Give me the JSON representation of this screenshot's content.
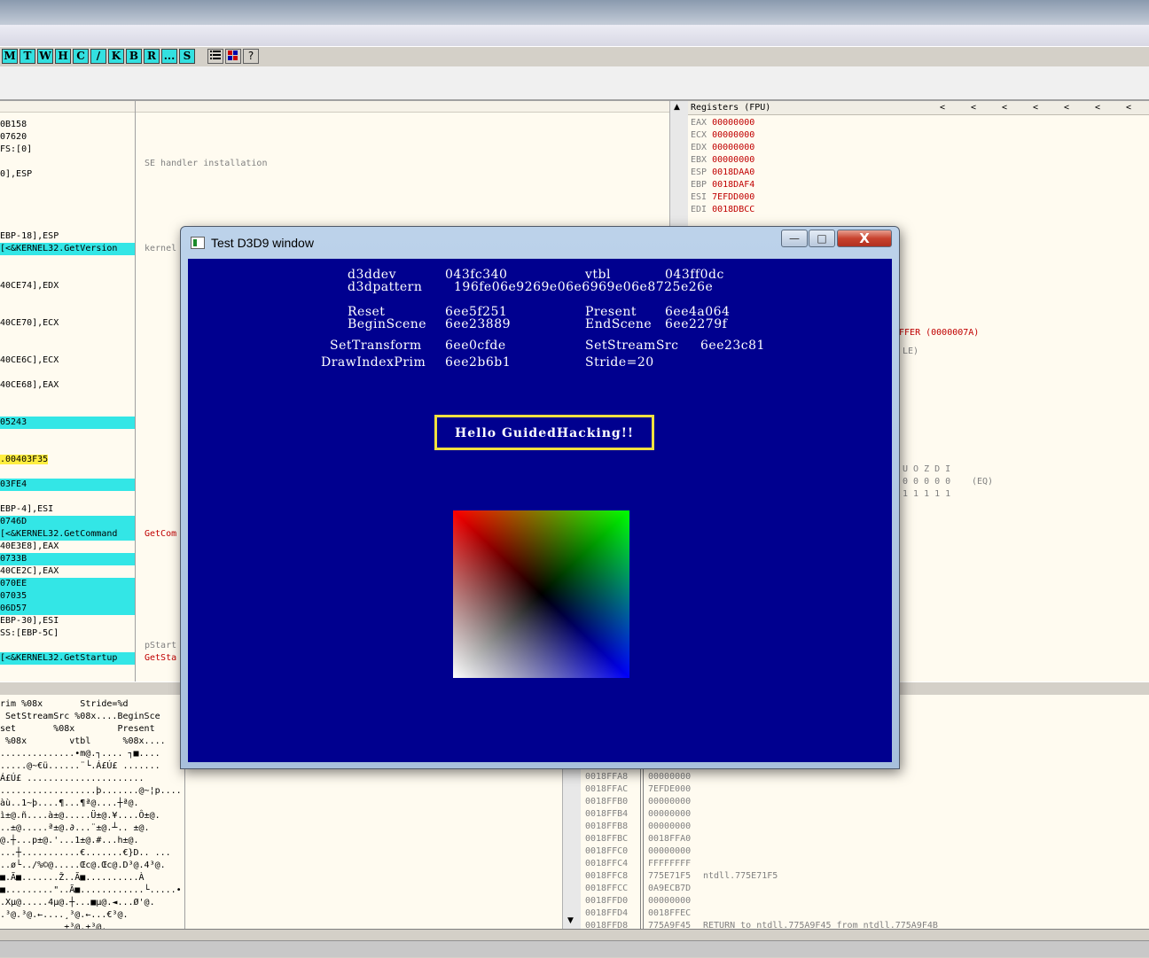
{
  "toolbar": {
    "buttons": [
      "M",
      "T",
      "W",
      "H",
      "C",
      "/",
      "K",
      "B",
      "R",
      "...",
      "S"
    ],
    "extra_icons": [
      "list-icon",
      "grid-icon",
      "?"
    ]
  },
  "cpu": {
    "lines": [
      {
        "text": "0B158",
        "style": ""
      },
      {
        "text": "07620",
        "style": ""
      },
      {
        "text": "FS:[0]",
        "style": ""
      },
      {
        "text": "",
        "style": ""
      },
      {
        "text": "0],ESP",
        "style": ""
      },
      {
        "text": "",
        "style": ""
      },
      {
        "text": "",
        "style": ""
      },
      {
        "text": "",
        "style": ""
      },
      {
        "text": "",
        "style": ""
      },
      {
        "text": "EBP-18],ESP",
        "style": ""
      },
      {
        "text": "[<&KERNEL32.GetVersion",
        "style": "hl"
      },
      {
        "text": "",
        "style": ""
      },
      {
        "text": "",
        "style": ""
      },
      {
        "text": "40CE74],EDX",
        "style": ""
      },
      {
        "text": "",
        "style": ""
      },
      {
        "text": "",
        "style": ""
      },
      {
        "text": "40CE70],ECX",
        "style": ""
      },
      {
        "text": "",
        "style": ""
      },
      {
        "text": "",
        "style": ""
      },
      {
        "text": "40CE6C],ECX",
        "style": ""
      },
      {
        "text": "",
        "style": ""
      },
      {
        "text": "40CE68],EAX",
        "style": ""
      },
      {
        "text": "",
        "style": ""
      },
      {
        "text": "",
        "style": ""
      },
      {
        "text": "05243",
        "style": "hl"
      },
      {
        "text": "",
        "style": ""
      },
      {
        "text": "",
        "style": ""
      },
      {
        "text": ".00403F35",
        "style": "yl"
      },
      {
        "text": "",
        "style": ""
      },
      {
        "text": "03FE4",
        "style": "hl"
      },
      {
        "text": "",
        "style": ""
      },
      {
        "text": "EBP-4],ESI",
        "style": ""
      },
      {
        "text": "0746D",
        "style": "hl"
      },
      {
        "text": "[<&KERNEL32.GetCommand",
        "style": "hl"
      },
      {
        "text": "40E3E8],EAX",
        "style": ""
      },
      {
        "text": "0733B",
        "style": "hl"
      },
      {
        "text": "40CE2C],EAX",
        "style": ""
      },
      {
        "text": "070EE",
        "style": "hl"
      },
      {
        "text": "07035",
        "style": "hl"
      },
      {
        "text": "06D57",
        "style": "hl"
      },
      {
        "text": "EBP-30],ESI",
        "style": ""
      },
      {
        "text": "SS:[EBP-5C]",
        "style": ""
      },
      {
        "text": "",
        "style": ""
      },
      {
        "text": "[<&KERNEL32.GetStartup",
        "style": "hl"
      }
    ],
    "comments": [
      {
        "text": "SE handler installation",
        "row": 3,
        "red": false
      },
      {
        "text": "kernel",
        "row": 10,
        "red": false
      },
      {
        "text": "GetCom",
        "row": 33,
        "red": true
      },
      {
        "text": "pStart",
        "row": 42,
        "red": false
      },
      {
        "text": "GetSta",
        "row": 43,
        "red": true
      }
    ]
  },
  "registers": {
    "header": "Registers (FPU)",
    "arrows": [
      "<",
      "<",
      "<",
      "<",
      "<",
      "<",
      "<"
    ],
    "rows": [
      {
        "name": "EAX",
        "value": "00000000"
      },
      {
        "name": "ECX",
        "value": "00000000"
      },
      {
        "name": "EDX",
        "value": "00000000"
      },
      {
        "name": "EBX",
        "value": "00000000"
      },
      {
        "name": "ESP",
        "value": "0018DAA0"
      },
      {
        "name": "EBP",
        "value": "0018DAF4"
      },
      {
        "name": "ESI",
        "value": "7EFDD000"
      },
      {
        "name": "EDI",
        "value": "0018DBCC"
      }
    ],
    "fragment_buffer": "UFFER (0000007A)",
    "fragment_le": "LE)",
    "flags_header": "U O Z D I",
    "flags_values": "0 0 0 0 0",
    "flags_eq": "(EQ)",
    "flags_ones": "1 1 1 1 1"
  },
  "dump": {
    "lines": [
      "rim %08x       Stride=%d",
      " SetStreamSrc %08x....BeginSce",
      "set       %08x        Present",
      " %08x        vtbl      %08x....",
      "..............•m@.┐.... ┐■....",
      ".....@~€ü......¨└.Á£Ú£ .......",
      "Á£Ú£ ......................",
      "..................þ.......@~¦p....",
      "àù..1~þ....¶...¶ª@....┼ª@.",
      "ì±@.ñ....à±@.....Ü±@.¥....Ô±@.",
      "..±@.....ª±@.∂...¨±@.┴.. ±@.",
      "@.┼...p±@.'...1±@.#...h±@.",
      "...┼...........€.......€}D.. ...",
      "..ø└../%©@.....Œc@.Œc@.D³@.4³@.",
      "■.Ã■.......Ž..Ã■..........À",
      "■.........\"..Ã■............└.....•",
      ".Xµ@.....4µ@.┼...■µ@.◄...Ø'@.",
      ".³@.³@.←....¸³@.←...€³@.",
      "            ±³@.±³@."
    ]
  },
  "stack": {
    "rows": [
      {
        "addr": "0018FFA8",
        "val": "00000000",
        "cmt": ""
      },
      {
        "addr": "0018FFAC",
        "val": "7EFDE000",
        "cmt": ""
      },
      {
        "addr": "0018FFB0",
        "val": "00000000",
        "cmt": ""
      },
      {
        "addr": "0018FFB4",
        "val": "00000000",
        "cmt": ""
      },
      {
        "addr": "0018FFB8",
        "val": "00000000",
        "cmt": ""
      },
      {
        "addr": "0018FFBC",
        "val": "0018FFA0",
        "cmt": ""
      },
      {
        "addr": "0018FFC0",
        "val": "00000000",
        "cmt": ""
      },
      {
        "addr": "0018FFC4",
        "val": "FFFFFFFF",
        "cmt": ""
      },
      {
        "addr": "0018FFC8",
        "val": "775E71F5",
        "cmt": "ntdll.775E71F5"
      },
      {
        "addr": "0018FFCC",
        "val": "0A9ECB7D",
        "cmt": ""
      },
      {
        "addr": "0018FFD0",
        "val": "00000000",
        "cmt": ""
      },
      {
        "addr": "0018FFD4",
        "val": "0018FFEC",
        "cmt": ""
      },
      {
        "addr": "0018FFD8",
        "val": "775A9F45",
        "cmt": "RETURN to ntdll.775A9F45 from ntdll.775A9F4B"
      }
    ]
  },
  "d3d_window": {
    "title": "Test D3D9 window",
    "minimize": "—",
    "maximize": "□",
    "close": "X",
    "info": {
      "d3ddev_label": "d3ddev",
      "d3ddev_value": "043fc340",
      "vtbl_label": "vtbl",
      "vtbl_value": "043ff0dc",
      "pattern_label": "d3dpattern",
      "pattern_value": "196fe06e9269e06e6969e06e8725e26e",
      "reset_label": "Reset",
      "reset_value": "6ee5f251",
      "present_label": "Present",
      "present_value": "6ee4a064",
      "beginscene_label": "BeginScene",
      "beginscene_value": "6ee23889",
      "endscene_label": "EndScene",
      "endscene_value": "6ee2279f",
      "settransform_label": "SetTransform",
      "settransform_value": "6ee0cfde",
      "setstreamsrc_label": "SetStreamSrc",
      "setstreamsrc_value": "6ee23c81",
      "drawindexprim_label": "DrawIndexPrim",
      "drawindexprim_value": "6ee2b6b1",
      "stride": "Stride=20"
    },
    "hello": "Hello GuidedHacking!!",
    "colors": {
      "background": "#00008f",
      "box_border": "#f0e040",
      "red": "#ff0000",
      "green": "#00ff00",
      "blue": "#0000ff",
      "white": "#ffffff"
    }
  }
}
